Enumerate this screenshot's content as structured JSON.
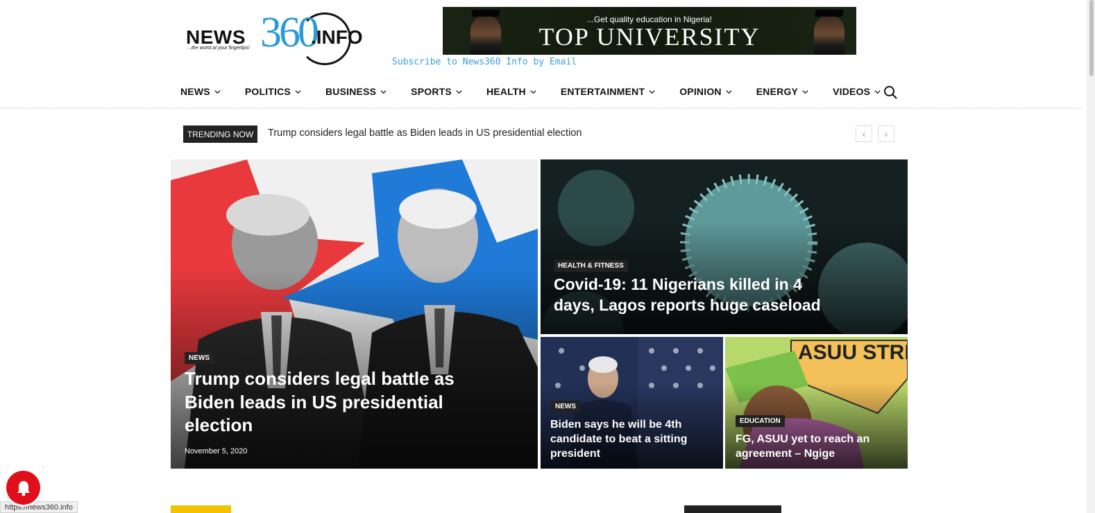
{
  "header": {
    "logo": {
      "news": "NEWS",
      "number": "360",
      "info": ".INFO",
      "tagline": "...the world at your fingertips!"
    },
    "ad": {
      "kicker": "...Get quality education in Nigeria!",
      "title": "TOP UNIVERSITY"
    },
    "subscribe_label": "Subscribe to News360 Info by Email"
  },
  "nav": {
    "items": [
      {
        "label": "NEWS"
      },
      {
        "label": "POLITICS"
      },
      {
        "label": "BUSINESS"
      },
      {
        "label": "SPORTS"
      },
      {
        "label": "HEALTH"
      },
      {
        "label": "ENTERTAINMENT"
      },
      {
        "label": "OPINION"
      },
      {
        "label": "ENERGY"
      },
      {
        "label": "VIDEOS"
      }
    ],
    "search_icon": "search-icon"
  },
  "trending": {
    "label": "TRENDING NOW",
    "headline": "Trump considers legal battle as Biden leads in US presidential election",
    "prev": "‹",
    "next": "›"
  },
  "featured": [
    {
      "category": "NEWS",
      "title": "Trump considers legal battle as Biden leads in US presidential election",
      "date": "November 5, 2020"
    },
    {
      "category": "HEALTH & FITNESS",
      "title": "Covid-19: 11 Nigerians killed in 4 days, Lagos reports huge caseload"
    },
    {
      "category": "NEWS",
      "title": "Biden says he will be 4th candidate to beat a sitting president"
    },
    {
      "category": "EDUCATION",
      "title": "FG, ASUU yet to reach an agreement – Ngige",
      "sign_text": "ASUU STRIKE"
    }
  ],
  "status_bar": {
    "url": "https://news360.info"
  },
  "colors": {
    "accent_blue": "#2a9bd7",
    "badge_dark": "#222222",
    "bell_red": "#e0101a",
    "section_yellow": "#f2c200"
  }
}
